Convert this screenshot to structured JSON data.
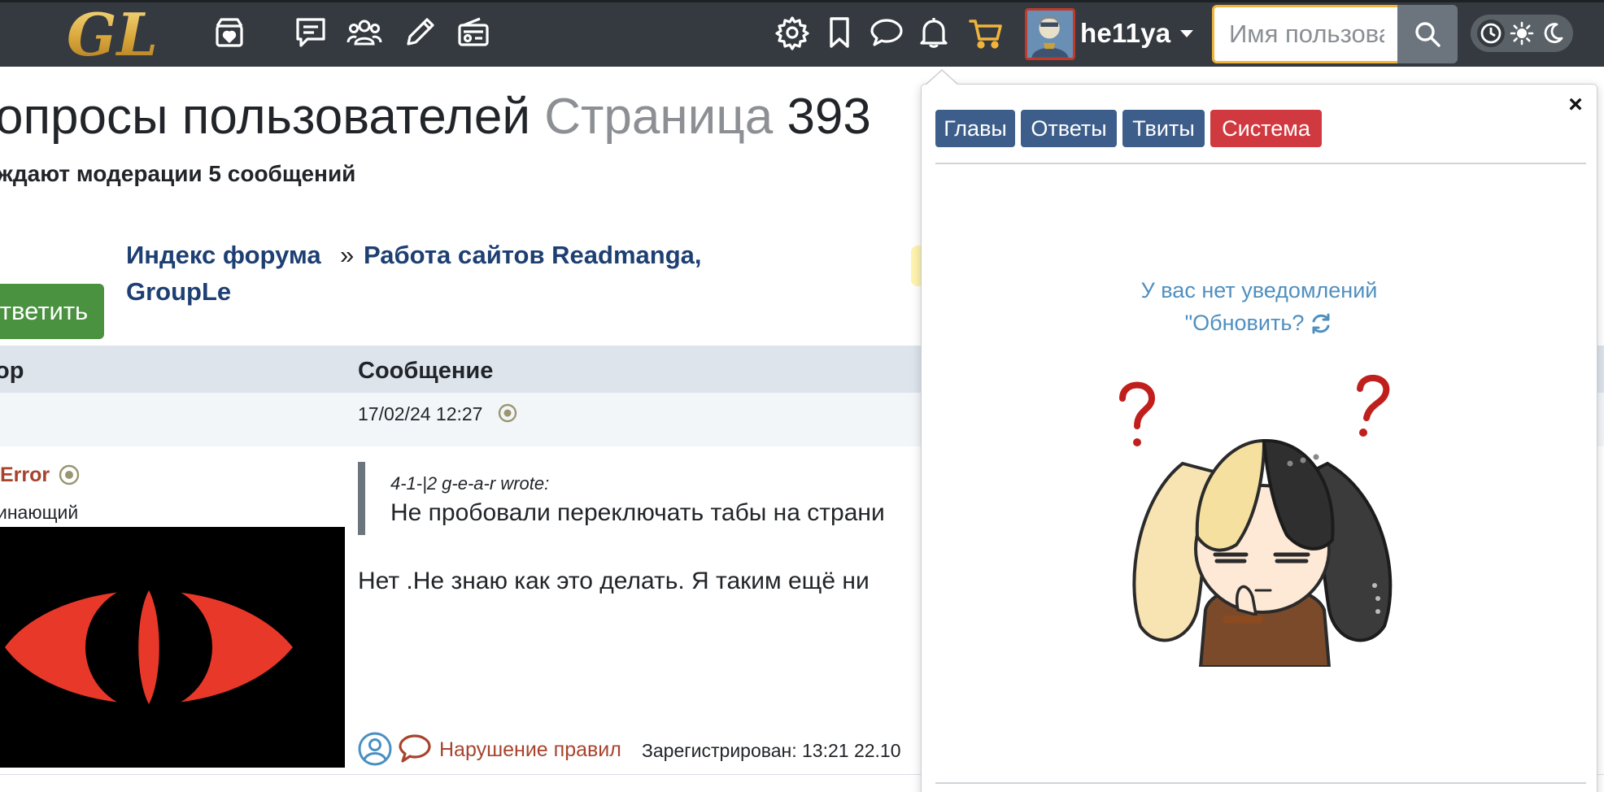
{
  "navbar": {
    "logo_text": "GL",
    "username": "he11ya",
    "search_placeholder": "Имя пользователя"
  },
  "forum": {
    "title_main": "опросы пользователей",
    "title_muted": "Страница",
    "title_page": "393",
    "moderation_note": "ждают модерации 5 сообщений",
    "breadcrumb_index": "Индекс форума",
    "breadcrumb_sep": "»",
    "breadcrumb_forum_line1": "Работа сайтов Readmanga,",
    "breadcrumb_forum_line2": "GroupLe",
    "reply_button": "тветить",
    "column_author": "ор",
    "column_message": "Сообщение",
    "post": {
      "date": "17/02/24 12:27",
      "author": "Error",
      "author_rank": "инающий",
      "quote_author": "4-1-|2 g-e-a-r wrote:",
      "quote_text": "Не пробовали переключать табы на страни",
      "reply_text": "Нет .Не знаю как это делать. Я таким ещё ни",
      "report_link": "Нарушение правил",
      "registered": "Зарегистрирован: 13:21 22.10"
    }
  },
  "notifications": {
    "tabs": [
      {
        "label": "Главы",
        "color": "#3d5e8a"
      },
      {
        "label": "Ответы",
        "color": "#3d5e8a"
      },
      {
        "label": "Твиты",
        "color": "#3d5e8a"
      },
      {
        "label": "Система",
        "color": "#d0393f"
      }
    ],
    "empty_line1": "У вас нет уведомлений",
    "empty_line2": "\"Обновить?",
    "close_symbol": "×"
  },
  "colors": {
    "navbar_bg": "#343a40",
    "accent_yellow": "#f0b43c",
    "link_blue": "#1d3f72",
    "author_red": "#a8432d",
    "reply_green": "#4a9140"
  },
  "icons": [
    "logo",
    "gift-box-icon",
    "chat-lines-icon",
    "users-icon",
    "pencil-icon",
    "radio-icon",
    "gear-icon",
    "bookmark-icon",
    "speech-bubble-icon",
    "bell-icon",
    "cart-icon",
    "user-caret-icon",
    "search-icon",
    "clock-icon",
    "sun-icon",
    "moon-icon",
    "close-icon",
    "refresh-icon",
    "profile-icon",
    "private-message-icon",
    "online-dot-icon"
  ]
}
